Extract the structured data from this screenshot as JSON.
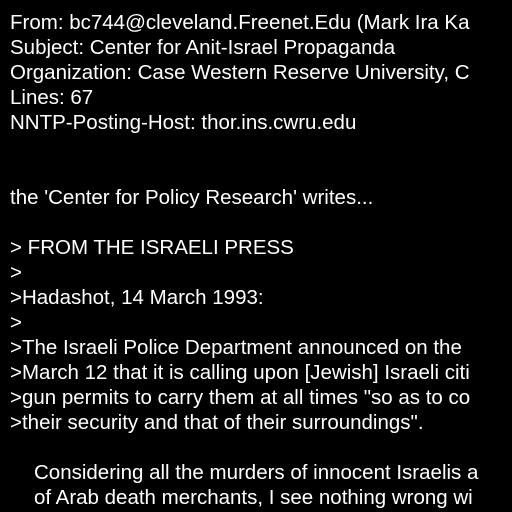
{
  "colors": {
    "background": "#000000",
    "text": "#ffffff"
  },
  "header": {
    "from": "From: bc744@cleveland.Freenet.Edu (Mark Ira Ka",
    "subject": "Subject: Center for Anit-Israel Propaganda",
    "organization": "Organization: Case Western Reserve University, C",
    "lines": "Lines: 67",
    "nntp_host": "NNTP-Posting-Host: thor.ins.cwru.edu"
  },
  "body": {
    "intro": "the 'Center for Policy Research' writes...",
    "quote": [
      "> FROM THE ISRAELI PRESS",
      ">",
      ">Hadashot, 14 March 1993:",
      ">",
      ">The Israeli Police Department announced on the",
      ">March 12 that it is calling upon [Jewish] Israeli citi",
      ">gun permits to carry them at all times \"so as to co",
      ">their security and that of their surroundings\"."
    ],
    "reply": [
      "Considering all the murders of innocent Israelis a",
      "of Arab death merchants, I see nothing wrong wi"
    ]
  }
}
